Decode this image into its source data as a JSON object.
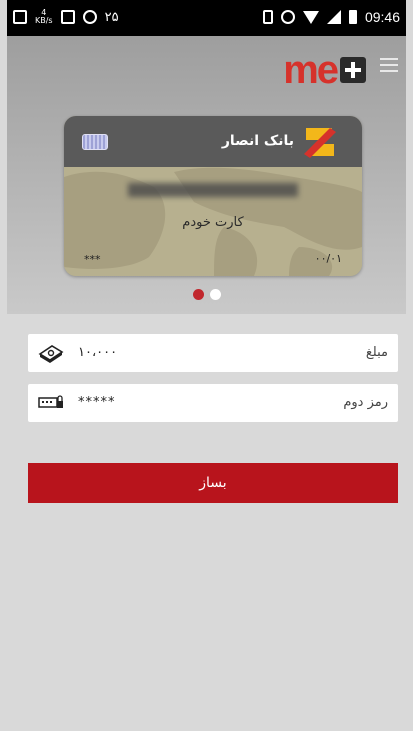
{
  "status_bar": {
    "left_icons": [
      "notification-icon",
      "speed-kbs-icon",
      "image-icon",
      "vpn-icon"
    ],
    "kbs_value": "4",
    "kbs_unit": "KB/s",
    "left_number": "۲۵",
    "time": "09:46"
  },
  "header": {
    "logo_text": "me",
    "logo_plus_icon": "plus-icon",
    "menu_icon": "hamburger-icon"
  },
  "card": {
    "bank_name": "بانک انصار",
    "label": "کارت خودم",
    "cvv_mask": "***",
    "expiry": "۰۰/۰۱"
  },
  "carousel": {
    "pages": 2,
    "active": 1
  },
  "form": {
    "amount": {
      "label": "مبلغ",
      "value": "۱۰،۰۰۰",
      "icon": "money-stack-icon"
    },
    "pin": {
      "label": "رمز دوم",
      "value": "*****",
      "icon": "keypad-icon"
    }
  },
  "submit_label": "بساز",
  "colors": {
    "brand_red": "#d6322b",
    "button_red": "#b8141c",
    "dot_active": "#c1272d"
  }
}
